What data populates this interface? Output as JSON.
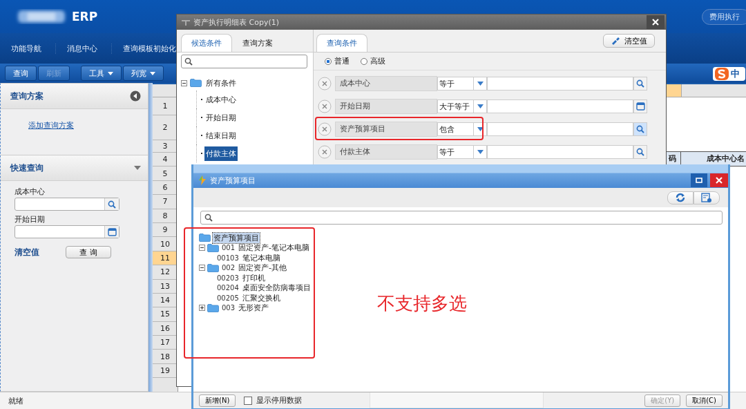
{
  "app": {
    "title": "ERP",
    "module_tab": "费用执行",
    "nav": [
      "功能导航",
      "消息中心",
      "查询模板初始化"
    ],
    "toolbar": [
      {
        "label": "查询",
        "disabled": false,
        "dropdown": false
      },
      {
        "label": "刷新",
        "disabled": true,
        "dropdown": false
      },
      {
        "label": "工具",
        "disabled": false,
        "dropdown": true
      },
      {
        "label": "列宽",
        "disabled": false,
        "dropdown": true
      }
    ],
    "ime": "中"
  },
  "left_panel": {
    "scheme_title": "查询方案",
    "add_scheme": "添加查询方案",
    "quick_title": "快速查询",
    "fields": [
      {
        "label": "成本中心",
        "kind": "lookup"
      },
      {
        "label": "开始日期",
        "kind": "date"
      }
    ],
    "clear": "清空值",
    "query": "查 询"
  },
  "grid": {
    "rows": [
      {
        "label": "1",
        "selected": false
      },
      {
        "label": "2",
        "selected": false
      },
      {
        "label": "3",
        "selected": false
      },
      {
        "label": "4",
        "selected": false
      },
      {
        "label": "5",
        "selected": false
      },
      {
        "label": "6",
        "selected": false
      },
      {
        "label": "7",
        "selected": false
      },
      {
        "label": "8",
        "selected": false
      },
      {
        "label": "9",
        "selected": false
      },
      {
        "label": "10",
        "selected": false
      },
      {
        "label": "11",
        "selected": true
      },
      {
        "label": "12",
        "selected": false
      },
      {
        "label": "13",
        "selected": false
      },
      {
        "label": "14",
        "selected": false
      },
      {
        "label": "15",
        "selected": false
      },
      {
        "label": "16",
        "selected": false
      },
      {
        "label": "17",
        "selected": false
      },
      {
        "label": "18",
        "selected": false
      },
      {
        "label": "19",
        "selected": false
      }
    ],
    "headers": [
      "码",
      "成本中心名"
    ]
  },
  "status_bar": "就绪",
  "query_dialog": {
    "title": "资产执行明细表 Copy(1)",
    "left_tabs": [
      {
        "label": "候选条件",
        "selected": true
      },
      {
        "label": "查询方案",
        "selected": false
      }
    ],
    "tree": {
      "label": "所有条件",
      "expanded": true,
      "children": [
        {
          "label": "成本中心",
          "selected": false
        },
        {
          "label": "开始日期",
          "selected": false
        },
        {
          "label": "结束日期",
          "selected": false
        },
        {
          "label": "付款主体",
          "selected": true
        }
      ]
    },
    "right_tab": "查询条件",
    "clear_button": "清空值",
    "modes": [
      {
        "label": "普通",
        "selected": true
      },
      {
        "label": "高级",
        "selected": false
      }
    ],
    "conditions": [
      {
        "field": "成本中心",
        "operator": "等于",
        "kind": "lookup",
        "active": false,
        "highlighted": false
      },
      {
        "field": "开始日期",
        "operator": "大于等于",
        "kind": "date",
        "active": false,
        "highlighted": false
      },
      {
        "field": "资产预算项目",
        "operator": "包含",
        "kind": "lookup",
        "active": true,
        "highlighted": true
      },
      {
        "field": "付款主体",
        "operator": "等于",
        "kind": "lookup",
        "active": false,
        "highlighted": false
      }
    ]
  },
  "budget_dialog": {
    "title": "资产预算项目",
    "tree_highlighted": true,
    "tree": {
      "name": "资产预算项目",
      "selected": true,
      "children": [
        {
          "code": "001",
          "name": "固定资产-笔记本电脑",
          "expanded": true,
          "selected": false,
          "children": [
            {
              "code": "00103",
              "name": "笔记本电脑",
              "selected": false
            }
          ]
        },
        {
          "code": "002",
          "name": "固定资产-其他",
          "expanded": true,
          "selected": false,
          "children": [
            {
              "code": "00203",
              "name": "打印机",
              "selected": false
            },
            {
              "code": "00204",
              "name": "桌面安全防病毒项目",
              "selected": false
            },
            {
              "code": "00205",
              "name": "汇聚交换机",
              "selected": false
            }
          ]
        },
        {
          "code": "003",
          "name": "无形资产",
          "expanded": false,
          "selected": false
        }
      ]
    },
    "new_button": "新增(N)",
    "show_disabled": {
      "label": "显示停用数据",
      "checked": false
    },
    "ok_button": {
      "label": "确定(Y)",
      "disabled": true
    },
    "cancel_button": "取消(C)"
  },
  "annotation": "不支持多选"
}
